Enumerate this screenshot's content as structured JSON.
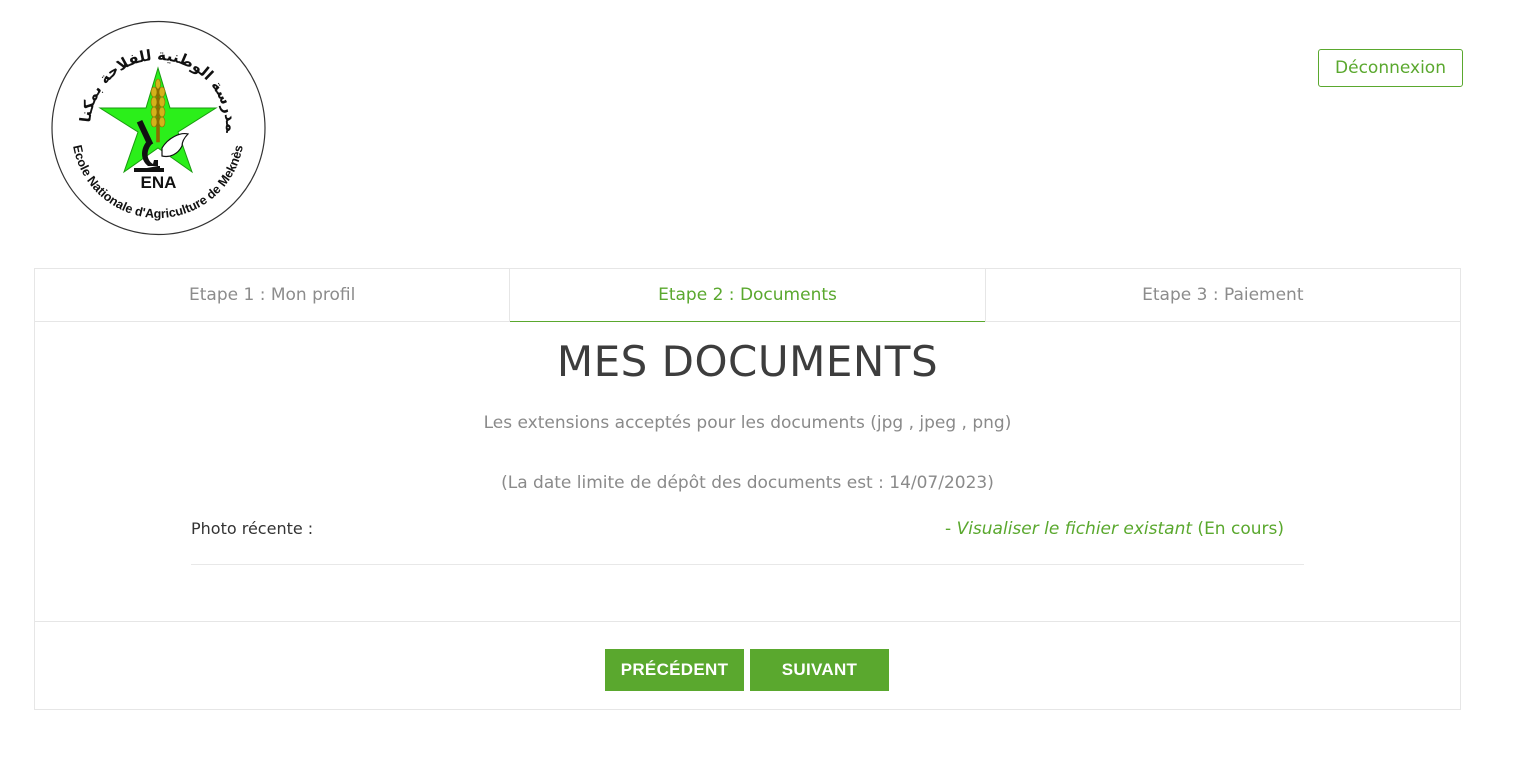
{
  "logo": {
    "ring_text_ar": "المدرسة الوطنية للفلاحة بمكناس",
    "ring_text_fr": "Ecole Nationale d'Agriculture de Meknès",
    "abbr": "ENA",
    "star_color": "#2bef1a"
  },
  "header": {
    "logout_label": "Déconnexion"
  },
  "tabs": [
    {
      "label": "Etape 1 : Mon profil",
      "active": false
    },
    {
      "label": "Etape 2 : Documents",
      "active": true
    },
    {
      "label": "Etape 3 : Paiement",
      "active": false
    }
  ],
  "main": {
    "title": "MES DOCUMENTS",
    "extensions_note": "Les extensions acceptés pour les documents (jpg , jpeg , png)",
    "deadline_note": "(La date limite de dépôt des documents est : 14/07/2023)",
    "documents": [
      {
        "label": "Photo récente :",
        "prefix": "- ",
        "link_text": "Visualiser le fichier existant",
        "status": " (En cours)"
      }
    ]
  },
  "footer": {
    "prev_label": "PRÉCÉDENT",
    "next_label": "SUIVANT"
  },
  "colors": {
    "accent": "#5aa82e",
    "title": "#3d3d3d",
    "muted": "#8a8a8a"
  }
}
